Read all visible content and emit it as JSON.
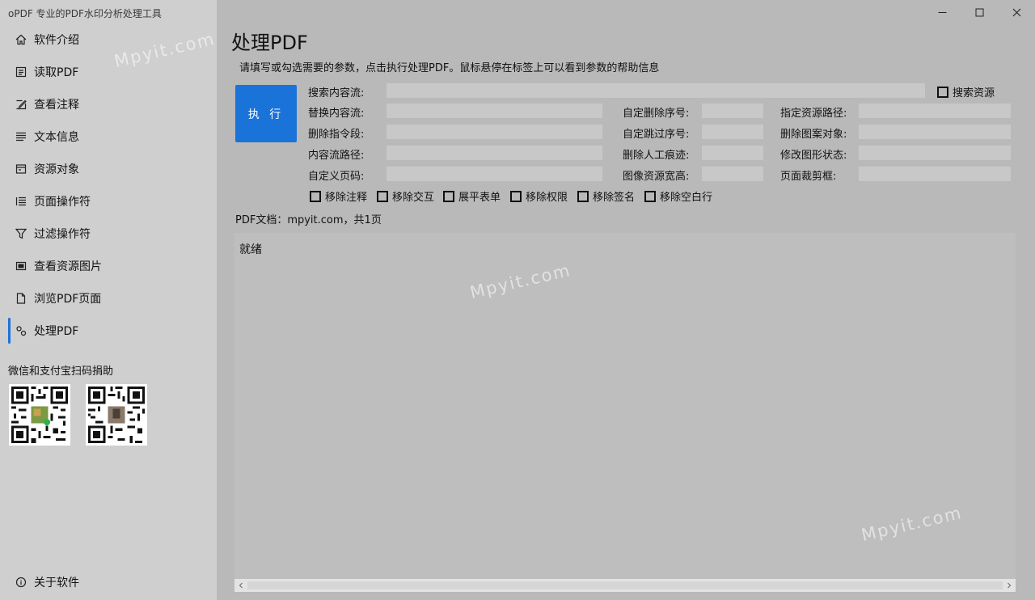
{
  "window": {
    "title": "oPDF 专业的PDF水印分析处理工具"
  },
  "sidebar": {
    "items": [
      {
        "label": "软件介绍",
        "icon": "home-icon"
      },
      {
        "label": "读取PDF",
        "icon": "read-pdf-icon"
      },
      {
        "label": "查看注释",
        "icon": "annotation-icon"
      },
      {
        "label": "文本信息",
        "icon": "text-lines-icon"
      },
      {
        "label": "资源对象",
        "icon": "resource-icon"
      },
      {
        "label": "页面操作符",
        "icon": "list-icon"
      },
      {
        "label": "过滤操作符",
        "icon": "filter-icon"
      },
      {
        "label": "查看资源图片",
        "icon": "image-icon"
      },
      {
        "label": "浏览PDF页面",
        "icon": "page-icon"
      },
      {
        "label": "处理PDF",
        "icon": "process-icon",
        "active": true
      }
    ],
    "donate_label": "微信和支付宝扫码捐助",
    "about_label": "关于软件"
  },
  "main": {
    "title": "处理PDF",
    "hint": "请填写或勾选需要的参数，点击执行处理PDF。鼠标悬停在标签上可以看到参数的帮助信息",
    "execute_label": "执 行",
    "search_stream_label": "搜索内容流:",
    "search_resource_label": "搜索资源",
    "rows": [
      {
        "col1": "替换内容流:",
        "col2": "自定删除序号:",
        "col3": "指定资源路径:"
      },
      {
        "col1": "删除指令段:",
        "col2": "自定跳过序号:",
        "col3": "删除图案对象:"
      },
      {
        "col1": "内容流路径:",
        "col2": "删除人工痕迹:",
        "col3": "修改图形状态:"
      },
      {
        "col1": "自定义页码:",
        "col2": "图像资源宽高:",
        "col3": "页面裁剪框:"
      }
    ],
    "options": [
      "移除注释",
      "移除交互",
      "展平表单",
      "移除权限",
      "移除签名",
      "移除空白行"
    ],
    "doc_info": "PDF文档：mpyit.com，共1页",
    "output_text": "就绪"
  },
  "watermark": "Mpyit.com",
  "colors": {
    "accent": "#1a73d9",
    "sidebar_bg": "#cfcfcf",
    "main_bg": "#b9b9b9"
  }
}
